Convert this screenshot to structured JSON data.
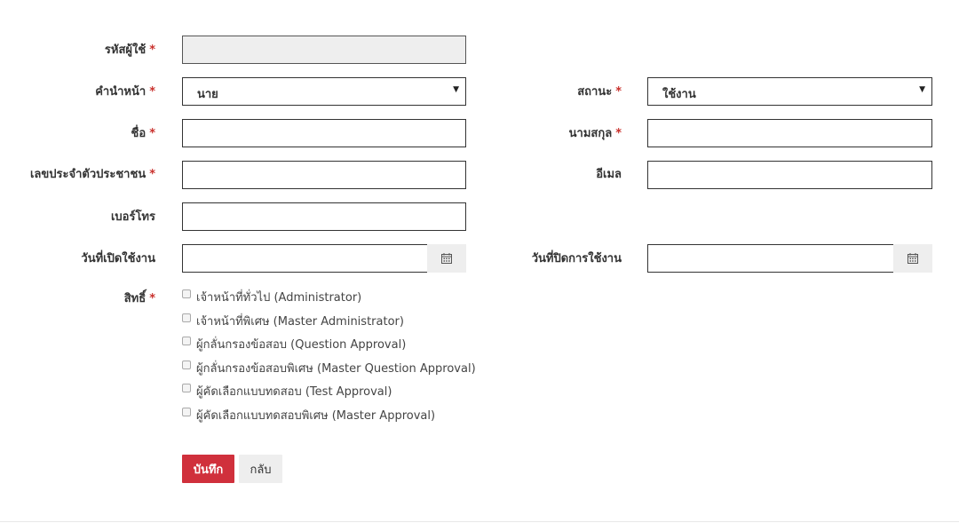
{
  "form": {
    "username": {
      "label": "รหัสผู้ใช้",
      "value": ""
    },
    "title": {
      "label": "คำนำหน้า",
      "value": "นาย"
    },
    "status": {
      "label": "สถานะ",
      "value": "ใช้งาน"
    },
    "first_name": {
      "label": "ชื่อ",
      "value": ""
    },
    "last_name": {
      "label": "นามสกุล",
      "value": ""
    },
    "citizen_id": {
      "label": "เลขประจำตัวประชาชน",
      "value": ""
    },
    "email": {
      "label": "อีเมล",
      "value": ""
    },
    "phone": {
      "label": "เบอร์โทร",
      "value": ""
    },
    "start_date": {
      "label": "วันที่เปิดใช้งาน",
      "value": ""
    },
    "end_date": {
      "label": "วันที่ปิดการใช้งาน",
      "value": ""
    },
    "rights": {
      "label": "สิทธิ์",
      "options": [
        {
          "label": "เจ้าหน้าที่ทั่วไป (Administrator)",
          "checked": false
        },
        {
          "label": "เจ้าหน้าที่พิเศษ (Master Administrator)",
          "checked": false
        },
        {
          "label": "ผู้กลั่นกรองข้อสอบ (Question Approval)",
          "checked": false
        },
        {
          "label": "ผู้กลั่นกรองข้อสอบพิเศษ (Master Question Approval)",
          "checked": false
        },
        {
          "label": "ผู้คัดเลือกแบบทดสอบ (Test Approval)",
          "checked": false
        },
        {
          "label": "ผู้คัดเลือกแบบทดสอบพิเศษ (Master Approval)",
          "checked": false
        }
      ]
    },
    "required_mark": "*"
  },
  "buttons": {
    "save": "บันทึก",
    "back": "กลับ"
  },
  "icons": {
    "calendar": "calendar-icon",
    "dropdown": "chevron-down-icon"
  },
  "colors": {
    "primary": "#d0303c",
    "required": "#c9302c"
  }
}
